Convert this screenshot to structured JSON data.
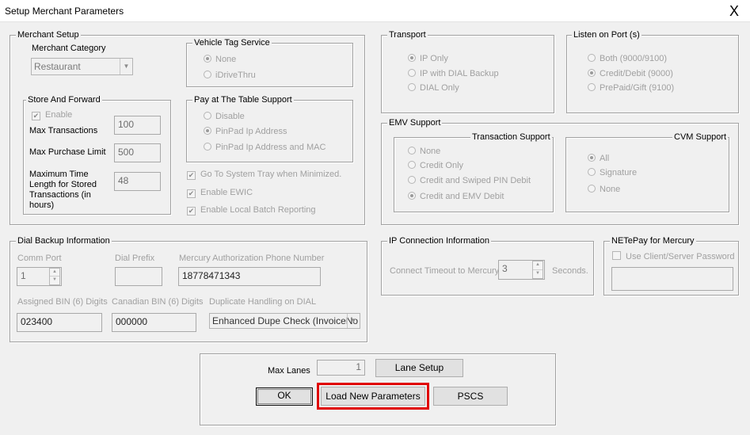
{
  "window": {
    "title": "Setup Merchant Parameters",
    "close_label": "X"
  },
  "merchant_setup": {
    "label": "Merchant Setup",
    "category_label": "Merchant Category",
    "category_value": "Restaurant",
    "store_forward": {
      "label": "Store And Forward",
      "enable_label": "Enable",
      "max_transactions_label": "Max Transactions",
      "max_transactions_value": "100",
      "max_purchase_label": "Max Purchase Limit",
      "max_purchase_value": "500",
      "max_time_label": "Maximum Time Length for Stored Transactions (in hours)",
      "max_time_value": "48"
    },
    "vehicle_tag": {
      "label": "Vehicle Tag Service",
      "options": [
        "None",
        "iDriveThru"
      ]
    },
    "pay_at_table": {
      "label": "Pay at The Table Support",
      "options": [
        "Disable",
        "PinPad Ip Address",
        "PinPad Ip Address and MAC"
      ]
    },
    "checkboxes": [
      "Go To System Tray when Minimized.",
      "Enable EWIC",
      "Enable Local Batch Reporting"
    ]
  },
  "transport": {
    "label": "Transport",
    "options": [
      "IP Only",
      "IP with DIAL Backup",
      "DIAL Only"
    ]
  },
  "listen_port": {
    "label": "Listen on Port (s)",
    "options": [
      "Both (9000/9100)",
      "Credit/Debit (9000)",
      "PrePaid/Gift (9100)"
    ]
  },
  "emv": {
    "label": "EMV Support",
    "transaction_support": {
      "label": "Transaction Support",
      "options": [
        "None",
        "Credit Only",
        "Credit and Swiped PIN Debit",
        "Credit and EMV Debit"
      ]
    },
    "cvm_support": {
      "label": "CVM Support",
      "options": [
        "All",
        "Signature",
        "None"
      ]
    }
  },
  "dial_backup": {
    "label": "Dial Backup Information",
    "comm_port_label": "Comm Port",
    "comm_port_value": "1",
    "dial_prefix_label": "Dial Prefix",
    "dial_prefix_value": "",
    "phone_label": "Mercury Authorization Phone Number",
    "phone_value": "18778471343",
    "assigned_bin_label": "Assigned BIN (6) Digits",
    "assigned_bin_value": "023400",
    "canadian_bin_label": "Canadian BIN (6) Digits",
    "canadian_bin_value": "000000",
    "dupe_label": "Duplicate Handling on DIAL",
    "dupe_value": "Enhanced Dupe Check (InvoiceNo"
  },
  "ip_connection": {
    "label": "IP Connection  Information",
    "timeout_label": "Connect Timeout to Mercury",
    "timeout_value": "3",
    "seconds_label": "Seconds."
  },
  "netepay": {
    "label": "NETePay for Mercury",
    "password_label": "Use Client/Server Password",
    "password_value": ""
  },
  "bottom": {
    "max_lanes_label": "Max Lanes",
    "max_lanes_value": "1",
    "lane_setup_label": "Lane Setup",
    "ok_label": "OK",
    "load_params_label": "Load New Parameters",
    "pscs_label": "PSCS"
  },
  "colors": {
    "highlight": "#e00000"
  }
}
